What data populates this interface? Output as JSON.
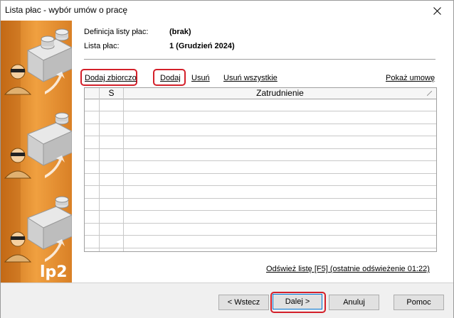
{
  "window": {
    "title": "Lista płac - wybór umów o pracę"
  },
  "info": {
    "definition_label": "Definicja listy płac:",
    "definition_value": "(brak)",
    "list_label": "Lista płac:",
    "list_value": "1 (Grudzień 2024)"
  },
  "actions": {
    "add_bulk": "Dodaj zbiorczo",
    "add": "Dodaj",
    "remove": "Usuń",
    "remove_all": "Usuń wszystkie",
    "show_contract": "Pokaż umowę"
  },
  "grid": {
    "columns": [
      "",
      "S",
      "Zatrudnienie"
    ],
    "rows": [
      "",
      "",
      "",
      "",
      "",
      "",
      "",
      "",
      "",
      "",
      "",
      ""
    ]
  },
  "refresh": {
    "label": "Odśwież listę [F5] (ostatnie odświeżenie 01:22)"
  },
  "side": {
    "logo_text": "lp2"
  },
  "footer": {
    "back": "< Wstecz",
    "next": "Dalej >",
    "cancel": "Anuluj",
    "help": "Pomoc"
  },
  "colors": {
    "highlight": "#d4202a",
    "side_panel": "#e58f2e"
  }
}
